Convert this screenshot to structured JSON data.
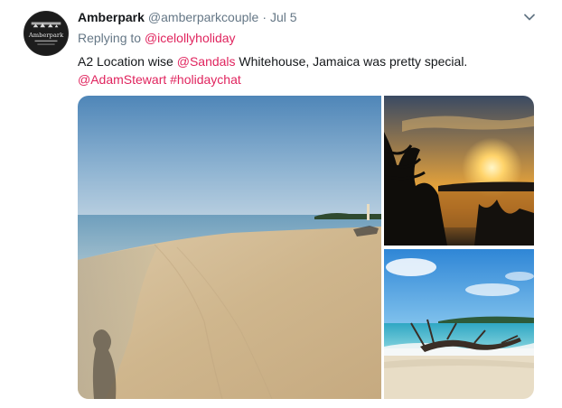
{
  "user": {
    "name": "Amberpark",
    "handle": "@amberparkcouple",
    "separator": "·",
    "date": "Jul 5",
    "avatar_text": "Amberpark"
  },
  "reply": {
    "prefix": "Replying to",
    "to": "@icelollyholiday"
  },
  "tweet": {
    "part1": "A2 Location wise ",
    "mention1": "@Sandals",
    "part2": " Whitehouse, Jamaica was pretty special.",
    "mention2": "@AdamStewart",
    "hashtag": "#holidaychat"
  },
  "icons": {
    "menu": "chevron-down-icon"
  },
  "colors": {
    "link": "#e0245e",
    "secondary_text": "#657786",
    "primary_text": "#14171a"
  }
}
